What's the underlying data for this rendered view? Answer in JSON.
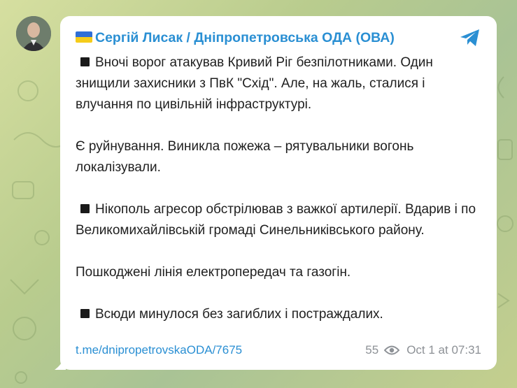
{
  "channel": {
    "flag_icon": "ukraine-flag-icon",
    "name": "Сергій Лисак / Дніпропетровська ОДА (ОВА)"
  },
  "post": {
    "paragraphs": [
      {
        "bullet": true,
        "text": "Вночі ворог атакував Кривий Ріг безпілотниками. Один знищили захисники з ПвК \"Схід\". Але, на жаль, сталися і влучання по цивільній інфраструктурі."
      },
      {
        "bullet": false,
        "text": "Є руйнування. Виникла пожежа – рятувальники вогонь локалізували."
      },
      {
        "bullet": true,
        "text": "Нікополь агресор обстрілював з важкої артилерії. Вдарив і по Великомихайлівській громаді Синельниківського району."
      },
      {
        "bullet": false,
        "text": "Пошкоджені лінія електропередач та газогін."
      },
      {
        "bullet": true,
        "text": "Всюди минулося без загиблих і постраждалих."
      }
    ],
    "link": "t.me/dnipropetrovskaODA/7675",
    "views": "55",
    "timestamp": "Oct 1 at 07:31"
  },
  "icons": {
    "share": "telegram-share-icon",
    "views": "eye-icon"
  },
  "colors": {
    "accent": "#2a8fd3",
    "text": "#1f1f1f",
    "meta": "#8d9196"
  }
}
